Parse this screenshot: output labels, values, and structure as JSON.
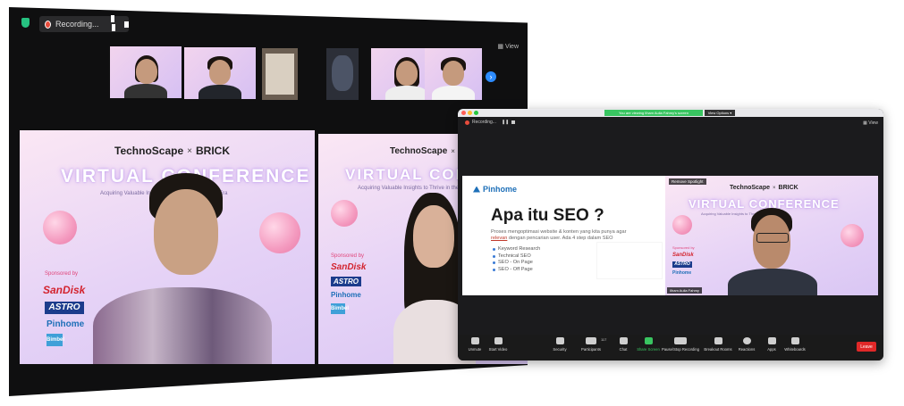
{
  "window_main": {
    "recording_label": "Recording...",
    "view_label": "View"
  },
  "tiles": {
    "brand_left": "TechnoScape",
    "brand_x": "×",
    "brand_right": "BRICK",
    "title": "VIRTUAL CONFERENCE",
    "subtitle": "Acquiring Valuable Insights to Thrive in the Digital Era",
    "sponsored_label": "Sponsored by",
    "sponsor_sandisk": "SanDisk",
    "sponsor_astro": "ASTRO",
    "sponsor_pinhome": "Pinhome",
    "sponsor_bimabasik": "Bimbel"
  },
  "window_share": {
    "banner_text": "You are viewing Ilham Aulia Fahmy's screen",
    "banner_button": "View Options ▾",
    "recording_label": "Recording...",
    "view_label": "View",
    "spotlight_label": "Remove Spotlight",
    "speaker_name": "Ilham Aulia Fahmy"
  },
  "slide": {
    "brand": "Pinhome",
    "title": "Apa itu SEO ?",
    "body_1": "Proses mengoptimasi website & konten yang kita punya agar",
    "body_emph": "relevan",
    "body_2": " dengan pencarian user. Ada 4 step dalam SEO",
    "bullets": [
      "Keyword Research",
      "Technical SEO",
      "SEO - On Page",
      "SEO - Off Page"
    ]
  },
  "toolbar": {
    "unmute": "Unmute",
    "start_video": "Start Video",
    "security": "Security",
    "participants": "Participants",
    "participants_count": "117",
    "chat": "Chat",
    "share_screen": "Share Screen",
    "recording": "Pause/Stop Recording",
    "breakout": "Breakout Rooms",
    "reactions": "Reactions",
    "apps": "Apps",
    "whiteboards": "Whiteboards",
    "leave": "Leave"
  },
  "colors": {
    "zoom_blue": "#2d8cff",
    "leave_red": "#e02828",
    "share_green": "#39c561",
    "slide_brand": "#1d6fb8"
  }
}
